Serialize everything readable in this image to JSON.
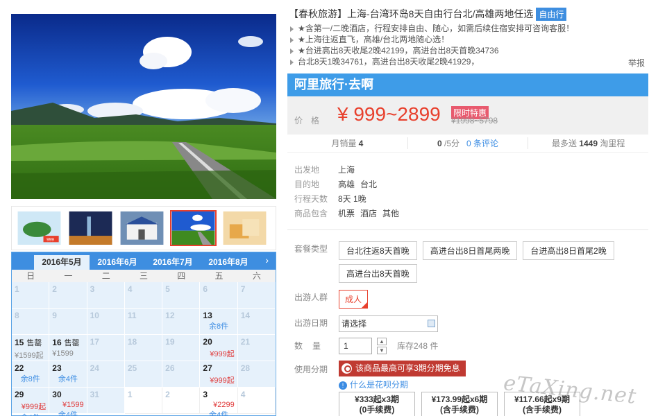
{
  "title": {
    "text": "【春秋旅游】上海-台湾环岛8天自由行台北/高雄两地任选",
    "badge": "自由行"
  },
  "features": [
    "★含第一/二晚酒店，行程安排自由、随心，如需后续住宿安排可咨询客服！",
    "★上海往返直飞，高雄/台北两地随心选！",
    "★台进高出8天收尾2晚42199，高进台出8天首晚34736",
    "台北8天1晚34761，高进台出8天收尾2晚41929，"
  ],
  "report_label": "举报",
  "brand": "阿里旅行·去啊",
  "price": {
    "label": "价格",
    "range": "¥ 999~2899",
    "flag": "限时特惠",
    "original": "¥1998~5798"
  },
  "stats": {
    "sales_label": "月销量",
    "sales_value": "4",
    "rating_value": "0",
    "rating_suffix": "/5分",
    "reviews": "0 条评论",
    "points_prefix": "最多送",
    "points_value": "1449",
    "points_suffix": "淘里程"
  },
  "info": {
    "departure_label": "出发地",
    "departure": "上海",
    "destination_label": "目的地",
    "destinations": [
      "高雄",
      "台北"
    ],
    "days_label": "行程天数",
    "days": "8天 1晚",
    "includes_label": "商品包含",
    "includes": [
      "机票",
      "酒店",
      "其他"
    ]
  },
  "options": {
    "package_label": "套餐类型",
    "packages": [
      "台北往返8天首晚",
      "高进台出8日首尾两晚",
      "台进高出8日首尾2晚",
      "高进台出8天首晚"
    ],
    "crowd_label": "出游人群",
    "crowd": "成人",
    "date_label": "出游日期",
    "date_placeholder": "请选择",
    "qty_label": "数量",
    "qty_value": "1",
    "stock": "库存248 件",
    "install_label": "使用分期",
    "install_banner": "该商品最高可享3期分期免息",
    "help": "什么是花呗分期",
    "plans": [
      {
        "line1": "¥333起x3期",
        "line2": "(0手续费)"
      },
      {
        "line1": "¥173.99起x6期",
        "line2": "(含手续费)"
      },
      {
        "line1": "¥117.66起x9期",
        "line2": "(含手续费)"
      }
    ]
  },
  "calendar": {
    "months": [
      "2016年5月",
      "2016年6月",
      "2016年7月",
      "2016年8月"
    ],
    "active_month": 0,
    "next_icon": "chevron-right-icon",
    "weekdays": [
      "日",
      "一",
      "二",
      "三",
      "四",
      "五",
      "六"
    ],
    "days": [
      {
        "n": "1"
      },
      {
        "n": "2"
      },
      {
        "n": "3"
      },
      {
        "n": "4"
      },
      {
        "n": "5"
      },
      {
        "n": "6"
      },
      {
        "n": "7"
      },
      {
        "n": "8"
      },
      {
        "n": "9"
      },
      {
        "n": "10"
      },
      {
        "n": "11"
      },
      {
        "n": "12"
      },
      {
        "n": "13",
        "avail": true,
        "stock": "余8件"
      },
      {
        "n": "14"
      },
      {
        "n": "15",
        "avail": true,
        "tag": "售罄",
        "price": "¥1599起",
        "grey": true
      },
      {
        "n": "16",
        "avail": true,
        "tag": "售罄",
        "price": "¥1599",
        "grey": true
      },
      {
        "n": "17"
      },
      {
        "n": "18"
      },
      {
        "n": "19"
      },
      {
        "n": "20",
        "avail": true,
        "price": "¥999起",
        "price2": "¥999起"
      },
      {
        "n": "21"
      },
      {
        "n": "22",
        "avail": true,
        "stock": "余8件"
      },
      {
        "n": "23",
        "avail": true,
        "stock": "余4件"
      },
      {
        "n": "24"
      },
      {
        "n": "25"
      },
      {
        "n": "26"
      },
      {
        "n": "27",
        "avail": true,
        "price": "¥999起"
      },
      {
        "n": "28"
      },
      {
        "n": "29",
        "avail": true,
        "price": "¥999起",
        "stock": "余4件"
      },
      {
        "n": "30",
        "avail": true,
        "price": "¥1599",
        "stock": "余4件"
      },
      {
        "n": "31"
      },
      {
        "n": "1",
        "other": true
      },
      {
        "n": "2",
        "other": true
      },
      {
        "n": "3",
        "avail": true,
        "other": true,
        "stock": "余4件",
        "price": "¥2299"
      },
      {
        "n": "4",
        "other": true
      }
    ]
  },
  "watermark": "eTaXing.net",
  "colors": {
    "accent": "#3e8ee0",
    "price": "#e8402d",
    "banner": "#c03a32"
  }
}
